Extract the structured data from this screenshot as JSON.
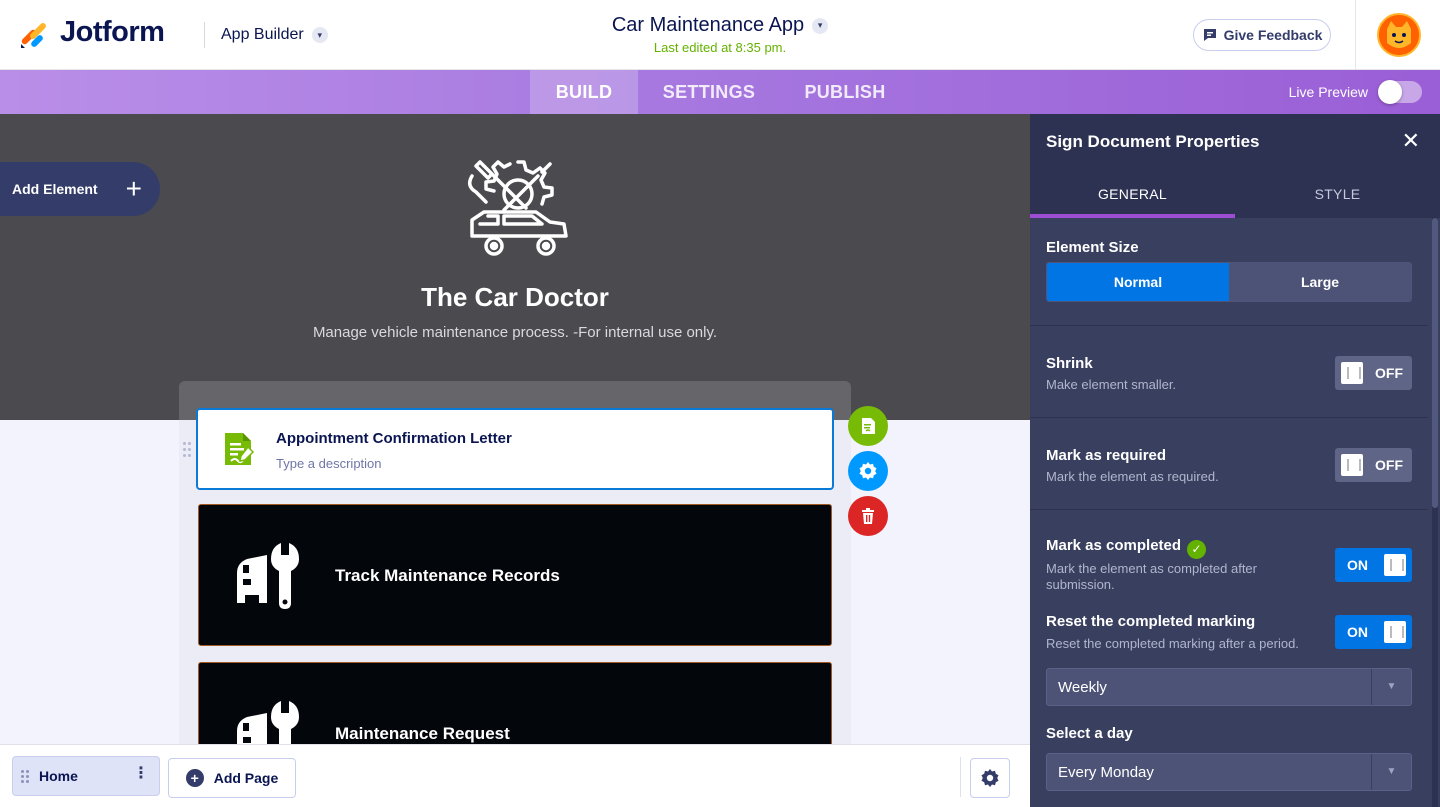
{
  "header": {
    "brand": "Jotform",
    "product": "App Builder",
    "app_title": "Car Maintenance App",
    "last_edited": "Last edited at 8:35 pm.",
    "feedback_label": "Give Feedback"
  },
  "nav": {
    "tabs": [
      "BUILD",
      "SETTINGS",
      "PUBLISH"
    ],
    "active_tab": "BUILD",
    "live_preview_label": "Live Preview",
    "live_preview_on": false
  },
  "canvas": {
    "add_element_label": "Add Element",
    "hero_title": "The Car Doctor",
    "hero_description": "Manage vehicle maintenance process. -For internal use only.",
    "items": [
      {
        "title": "Appointment Confirmation Letter",
        "description": "Type a description",
        "icon": "sign-document-icon"
      },
      {
        "title": "Track Maintenance Records",
        "icon": "car-wrench-icon"
      },
      {
        "title": "Maintenance Request",
        "icon": "car-wrench-icon"
      }
    ]
  },
  "bottom": {
    "page_tab": "Home",
    "add_page_label": "Add Page"
  },
  "props": {
    "title": "Sign Document Properties",
    "tabs": [
      "GENERAL",
      "STYLE"
    ],
    "active_tab": "GENERAL",
    "element_size": {
      "label": "Element Size",
      "options": [
        "Normal",
        "Large"
      ],
      "selected": "Normal"
    },
    "shrink": {
      "label": "Shrink",
      "desc": "Make element smaller.",
      "state": "OFF"
    },
    "required": {
      "label": "Mark as required",
      "desc": "Mark the element as required.",
      "state": "OFF"
    },
    "completed": {
      "label": "Mark as completed",
      "desc": "Mark the element as completed after submission.",
      "state": "ON"
    },
    "reset": {
      "label": "Reset the completed marking",
      "desc": "Reset the completed marking after a period.",
      "state": "ON"
    },
    "period": {
      "value": "Weekly"
    },
    "day": {
      "label": "Select a day",
      "value": "Every Monday"
    }
  },
  "colors": {
    "brand_navy": "#0a1551",
    "accent_blue": "#0075e3",
    "accent_purple": "#9c4dd3",
    "success_green": "#64b200",
    "danger_red": "#dc2626"
  }
}
